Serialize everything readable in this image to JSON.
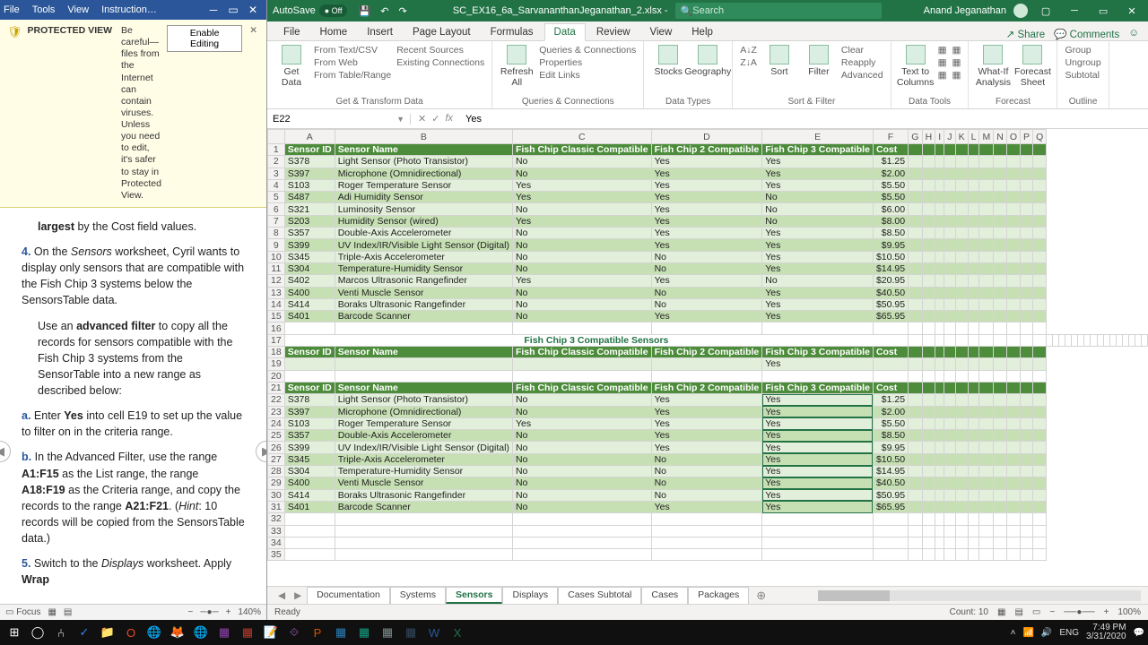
{
  "word": {
    "tabs": [
      "File",
      "Tools",
      "View",
      "Instruction…"
    ],
    "protected": {
      "label": "PROTECTED VIEW",
      "msg": "Be careful—files from the Internet can contain viruses. Unless you need to edit, it's safer to stay in Protected View.",
      "btn": "Enable Editing"
    },
    "body": {
      "p1a": "largest",
      "p1b": " by the Cost field values.",
      "p2num": "4.",
      "p2a": "On the ",
      "p2b": "Sensors",
      "p2c": " worksheet, Cyril wants to display only sensors that are compatible with the Fish Chip 3 systems below the SensorsTable data.",
      "p3a": "Use an ",
      "p3b": "advanced filter",
      "p3c": " to copy all the records for sensors compatible with the Fish Chip 3 systems from the SensorTable into a new range as described below:",
      "paA": "a.",
      "paA1": "Enter ",
      "paA2": "Yes",
      "paA3": " into cell E19 to set up the value to filter on in the criteria range.",
      "paB": "b.",
      "paB1": "In the Advanced Filter, use the range ",
      "paB2": "A1:F15",
      "paB3": " as the List range, the range ",
      "paB4": "A18:F19",
      "paB5": " as the Criteria range, and copy the records to the range ",
      "paB6": "A21:F21",
      "paB7": ". (",
      "paB8": "Hint",
      "paB9": ": 10 records will be copied from the SensorsTable data.)",
      "p5num": "5.",
      "p5a": "Switch to the ",
      "p5b": "Displays",
      "p5c": " worksheet. Apply ",
      "p5d": "Wrap"
    },
    "status": {
      "focus": "Focus",
      "zoom": "140%"
    }
  },
  "excel": {
    "autosave": "AutoSave",
    "autosave_state": "● Off",
    "filename": "SC_EX16_6a_SarvananthanJeganathan_2.xlsx  -",
    "search_ph": "Search",
    "user": "Anand Jeganathan",
    "tabs": [
      "File",
      "Home",
      "Insert",
      "Page Layout",
      "Formulas",
      "Data",
      "Review",
      "View",
      "Help"
    ],
    "active_tab": "Data",
    "share": "Share",
    "comments": "Comments",
    "ribbon_groups": {
      "g1": {
        "big": "Get Data",
        "items": [
          "From Text/CSV",
          "From Web",
          "From Table/Range",
          "Recent Sources",
          "Existing Connections"
        ],
        "label": "Get & Transform Data"
      },
      "g2": {
        "big": "Refresh All",
        "items": [
          "Queries & Connections",
          "Properties",
          "Edit Links"
        ],
        "label": "Queries & Connections"
      },
      "g3": {
        "b1": "Stocks",
        "b2": "Geography",
        "label": "Data Types"
      },
      "g4": {
        "b1": "Sort",
        "b2": "Filter",
        "items": [
          "Clear",
          "Reapply",
          "Advanced"
        ],
        "label": "Sort & Filter"
      },
      "g5": {
        "b1": "Text to Columns",
        "label": "Data Tools"
      },
      "g6": {
        "b1": "What-If Analysis",
        "b2": "Forecast Sheet",
        "label": "Forecast"
      },
      "g7": {
        "items": [
          "Group",
          "Ungroup",
          "Subtotal"
        ],
        "label": "Outline"
      }
    },
    "namebox": "E22",
    "formula": "Yes",
    "cols": [
      "A",
      "B",
      "C",
      "D",
      "E",
      "F",
      "G",
      "H",
      "I",
      "J",
      "K",
      "L",
      "M",
      "N",
      "O",
      "P",
      "Q"
    ],
    "headers": [
      "Sensor ID",
      "Sensor Name",
      "Fish Chip Classic Compatible",
      "Fish Chip 2 Compatible",
      "Fish Chip 3 Compatible",
      "Cost"
    ],
    "table1": [
      [
        "S378",
        "Light Sensor (Photo Transistor)",
        "No",
        "Yes",
        "Yes",
        "$1.25"
      ],
      [
        "S397",
        "Microphone (Omnidirectional)",
        "No",
        "Yes",
        "Yes",
        "$2.00"
      ],
      [
        "S103",
        "Roger Temperature Sensor",
        "Yes",
        "Yes",
        "Yes",
        "$5.50"
      ],
      [
        "S487",
        "Adi Humidity Sensor",
        "Yes",
        "Yes",
        "No",
        "$5.50"
      ],
      [
        "S321",
        "Luminosity Sensor",
        "No",
        "Yes",
        "No",
        "$6.00"
      ],
      [
        "S203",
        "Humidity Sensor (wired)",
        "Yes",
        "Yes",
        "No",
        "$8.00"
      ],
      [
        "S357",
        "Double-Axis Accelerometer",
        "No",
        "Yes",
        "Yes",
        "$8.50"
      ],
      [
        "S399",
        "UV Index/IR/Visible Light Sensor (Digital)",
        "No",
        "Yes",
        "Yes",
        "$9.95"
      ],
      [
        "S345",
        "Triple-Axis Accelerometer",
        "No",
        "No",
        "Yes",
        "$10.50"
      ],
      [
        "S304",
        "Temperature-Humidity Sensor",
        "No",
        "No",
        "Yes",
        "$14.95"
      ],
      [
        "S402",
        "Marcos Ultrasonic Rangefinder",
        "Yes",
        "Yes",
        "No",
        "$20.95"
      ],
      [
        "S400",
        "Venti Muscle Sensor",
        "No",
        "No",
        "Yes",
        "$40.50"
      ],
      [
        "S414",
        "Boraks Ultrasonic Rangefinder",
        "No",
        "No",
        "Yes",
        "$50.95"
      ],
      [
        "S401",
        "Barcode Scanner",
        "No",
        "Yes",
        "Yes",
        "$65.95"
      ]
    ],
    "title_row": "Fish Chip 3 Compatible Sensors",
    "criteria_val": "Yes",
    "table2": [
      [
        "S378",
        "Light Sensor (Photo Transistor)",
        "No",
        "Yes",
        "Yes",
        "$1.25"
      ],
      [
        "S397",
        "Microphone (Omnidirectional)",
        "No",
        "Yes",
        "Yes",
        "$2.00"
      ],
      [
        "S103",
        "Roger Temperature Sensor",
        "Yes",
        "Yes",
        "Yes",
        "$5.50"
      ],
      [
        "S357",
        "Double-Axis Accelerometer",
        "No",
        "Yes",
        "Yes",
        "$8.50"
      ],
      [
        "S399",
        "UV Index/IR/Visible Light Sensor (Digital)",
        "No",
        "Yes",
        "Yes",
        "$9.95"
      ],
      [
        "S345",
        "Triple-Axis Accelerometer",
        "No",
        "No",
        "Yes",
        "$10.50"
      ],
      [
        "S304",
        "Temperature-Humidity Sensor",
        "No",
        "No",
        "Yes",
        "$14.95"
      ],
      [
        "S400",
        "Venti Muscle Sensor",
        "No",
        "No",
        "Yes",
        "$40.50"
      ],
      [
        "S414",
        "Boraks Ultrasonic Rangefinder",
        "No",
        "No",
        "Yes",
        "$50.95"
      ],
      [
        "S401",
        "Barcode Scanner",
        "No",
        "Yes",
        "Yes",
        "$65.95"
      ]
    ],
    "sheet_tabs": [
      "Documentation",
      "Systems",
      "Sensors",
      "Displays",
      "Cases Subtotal",
      "Cases",
      "Packages"
    ],
    "active_sheet": "Sensors",
    "status": {
      "ready": "Ready",
      "count": "Count: 10",
      "zoom": "100%"
    }
  },
  "taskbar": {
    "icons": [
      "⊞",
      "◯",
      "⑃",
      "✓",
      "📁",
      "O",
      "🌐",
      "🦊",
      "🌐",
      "▦",
      "▦",
      "📝",
      "⟐",
      "P",
      "▦",
      "▦",
      "▦",
      "▦",
      "W",
      "X"
    ],
    "tray": {
      "lang": "ENG",
      "time": "7:49 PM",
      "date": "3/31/2020"
    }
  }
}
